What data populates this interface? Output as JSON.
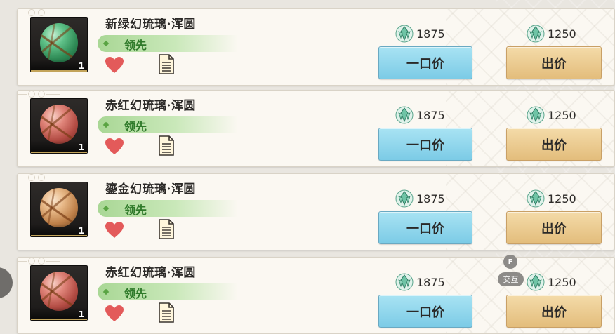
{
  "listings": [
    {
      "name": "新绿幻琉璃·浑圆",
      "status": "领先",
      "quantity": "1",
      "buyout_price": "1875",
      "bid_price": "1250",
      "buyout_label": "一口价",
      "bid_label": "出价",
      "orb_color": "#3fa86a"
    },
    {
      "name": "赤红幻琉璃·浑圆",
      "status": "领先",
      "quantity": "1",
      "buyout_price": "1875",
      "bid_price": "1250",
      "buyout_label": "一口价",
      "bid_label": "出价",
      "orb_color": "#d2645a"
    },
    {
      "name": "鎏金幻琉璃·浑圆",
      "status": "领先",
      "quantity": "1",
      "buyout_price": "1875",
      "bid_price": "1250",
      "buyout_label": "一口价",
      "bid_label": "出价",
      "orb_color": "#d7a36a"
    },
    {
      "name": "赤红幻琉璃·浑圆",
      "status": "领先",
      "quantity": "1",
      "buyout_price": "1875",
      "bid_price": "1250",
      "buyout_label": "一口价",
      "bid_label": "出价",
      "orb_color": "#d2645a"
    }
  ],
  "interaction_prompt": {
    "key": "F",
    "label": "交互"
  },
  "icons": {
    "currency": "crystal-currency-icon",
    "favorite": "heart-icon",
    "details": "document-icon",
    "status": "diamond-icon"
  },
  "colors": {
    "buyout_button": "#8fd6ec",
    "bid_button": "#eccb91",
    "lead_badge": "#a9d795",
    "heart": "#e35a5a"
  }
}
